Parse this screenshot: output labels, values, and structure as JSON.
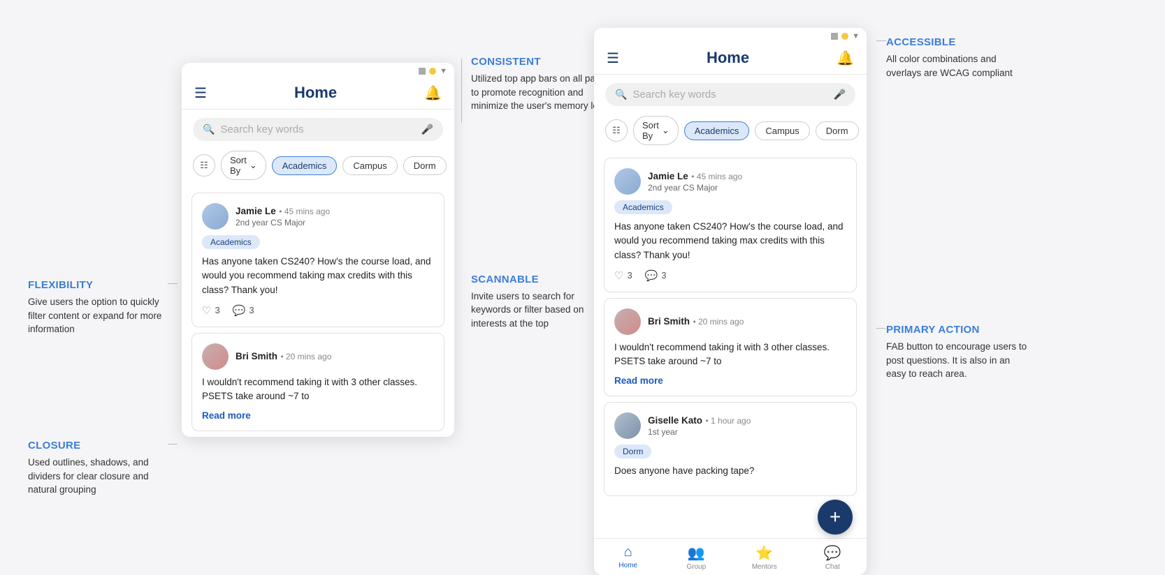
{
  "page": {
    "bg": "#f5f5f7"
  },
  "annotations": {
    "flexibility_title": "FLEXIBILITY",
    "flexibility_text": "Give users the option to quickly filter content or expand for more information",
    "closure_title": "CLOSURE",
    "closure_text": "Used outlines, shadows, and dividers for clear closure and natural grouping",
    "consistent_title": "CONSISTENT",
    "consistent_text": "Utilized top app bars on all pages to promote recognition and minimize the user's memory load",
    "scannable_title": "SCANNABLE",
    "scannable_text": "Invite users to search for keywords or filter based on interests at the top",
    "accessible_title": "ACCESSIBLE",
    "accessible_text": "All color combinations and overlays are WCAG compliant",
    "primary_action_title": "PRIMARY ACTION",
    "primary_action_text": "FAB button to encourage users to post questions. It is also in an easy to reach area."
  },
  "phone1": {
    "title": "Home",
    "search_placeholder": "Search key words",
    "sort_label": "Sort By",
    "tags": [
      "Academics",
      "Campus",
      "Dorm"
    ],
    "active_tag": "Academics",
    "posts": [
      {
        "author": "Jamie Le",
        "time": "45 mins ago",
        "subtitle": "2nd year CS Major",
        "tag": "Academics",
        "body": "Has anyone taken CS240? How's the course load, and would you recommend taking max credits with this class? Thank you!",
        "likes": "3",
        "comments": "3"
      },
      {
        "author": "Bri Smith",
        "time": "20 mins ago",
        "subtitle": "",
        "tag": "",
        "body": "I wouldn't recommend taking it with 3 other classes. PSETS take around ~7 to",
        "read_more": "Read more",
        "likes": "",
        "comments": ""
      }
    ]
  },
  "phone2": {
    "title": "Home",
    "search_placeholder": "Search key words",
    "sort_label": "Sort By",
    "tags": [
      "Academics",
      "Campus",
      "Dorm"
    ],
    "active_tag": "Academics",
    "posts": [
      {
        "author": "Jamie Le",
        "time": "45 mins ago",
        "subtitle": "2nd year CS Major",
        "tag": "Academics",
        "body": "Has anyone taken CS240? How's the course load, and would you recommend taking max credits with this class? Thank you!",
        "likes": "3",
        "comments": "3"
      },
      {
        "author": "Bri Smith",
        "time": "20 mins ago",
        "subtitle": "",
        "tag": "",
        "body": "I wouldn't recommend taking it with 3 other classes. PSETS take around ~7 to",
        "read_more": "Read more",
        "likes": "",
        "comments": ""
      },
      {
        "author": "Giselle Kato",
        "time": "1 hour ago",
        "subtitle": "1st year",
        "tag": "Dorm",
        "body": "Does anyone have packing tape?",
        "likes": "",
        "comments": ""
      }
    ],
    "nav": [
      "Home",
      "Group",
      "Mentors",
      "Chat"
    ],
    "fab_label": "+",
    "active_nav": "Home"
  }
}
